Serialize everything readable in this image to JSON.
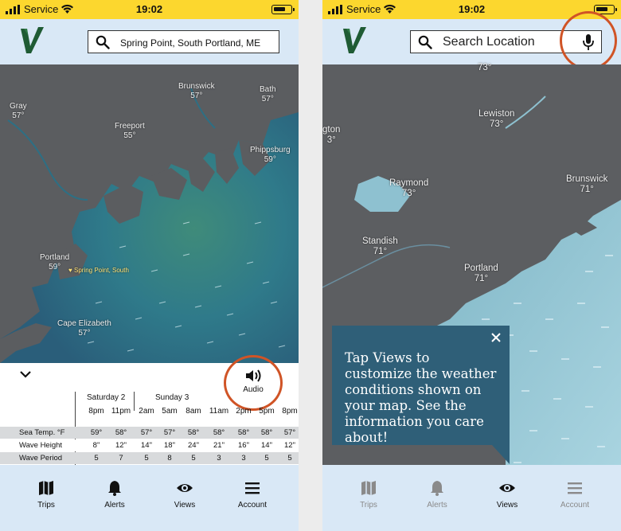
{
  "status_bar": {
    "carrier": "Service",
    "time": "19:02"
  },
  "left": {
    "search_value": "Spring Point, South Portland, ME",
    "map_labels": [
      {
        "name": "Brunswick",
        "temp": "57°"
      },
      {
        "name": "Bath",
        "temp": "57°"
      },
      {
        "name": "Gray",
        "temp": "57°"
      },
      {
        "name": "Freeport",
        "temp": "55°"
      },
      {
        "name": "Phippsburg",
        "temp": "59°"
      },
      {
        "name": "Portland",
        "temp": "59°"
      },
      {
        "name": "Cape Elizabeth",
        "temp": "57°"
      }
    ],
    "poi_label": "Spring Point, South",
    "audio_label": "Audio",
    "forecast": {
      "days": [
        "Saturday 2",
        "Sunday 3"
      ],
      "times": [
        "8pm",
        "11pm",
        "2am",
        "5am",
        "8am",
        "11am",
        "2pm",
        "5pm",
        "8pm"
      ],
      "rows": [
        {
          "label": "Sea Temp. °F",
          "values": [
            "59°",
            "58°",
            "57°",
            "57°",
            "58°",
            "58°",
            "58°",
            "58°",
            "57°"
          ]
        },
        {
          "label": "Wave Height",
          "values": [
            "8\"",
            "12\"",
            "14\"",
            "18\"",
            "24\"",
            "21\"",
            "16\"",
            "14\"",
            "12\""
          ]
        },
        {
          "label": "Wave Period",
          "values": [
            "5",
            "7",
            "5",
            "8",
            "5",
            "3",
            "3",
            "5",
            "5"
          ]
        }
      ]
    }
  },
  "right": {
    "search_placeholder": "Search Location",
    "map_labels": [
      {
        "name": "",
        "temp": "73°"
      },
      {
        "name": "Lewiston",
        "temp": "73°"
      },
      {
        "name": "gton",
        "temp": "3°"
      },
      {
        "name": "Brunswick",
        "temp": "71°"
      },
      {
        "name": "Raymond",
        "temp": "73°"
      },
      {
        "name": "Standish",
        "temp": "71°"
      },
      {
        "name": "Portland",
        "temp": "71°"
      }
    ],
    "tooltip_text": "Tap Views to customize the weather conditions shown on your map. See the information you care about!"
  },
  "tabs": [
    {
      "label": "Trips",
      "icon": "map-icon"
    },
    {
      "label": "Alerts",
      "icon": "bell-icon"
    },
    {
      "label": "Views",
      "icon": "eye-icon"
    },
    {
      "label": "Account",
      "icon": "menu-icon"
    }
  ],
  "colors": {
    "status_bar": "#fcd72e",
    "header": "#d9e8f6",
    "highlight_ring": "#d05426",
    "tooltip": "#2f5f78",
    "logo": "#1f5b34"
  }
}
